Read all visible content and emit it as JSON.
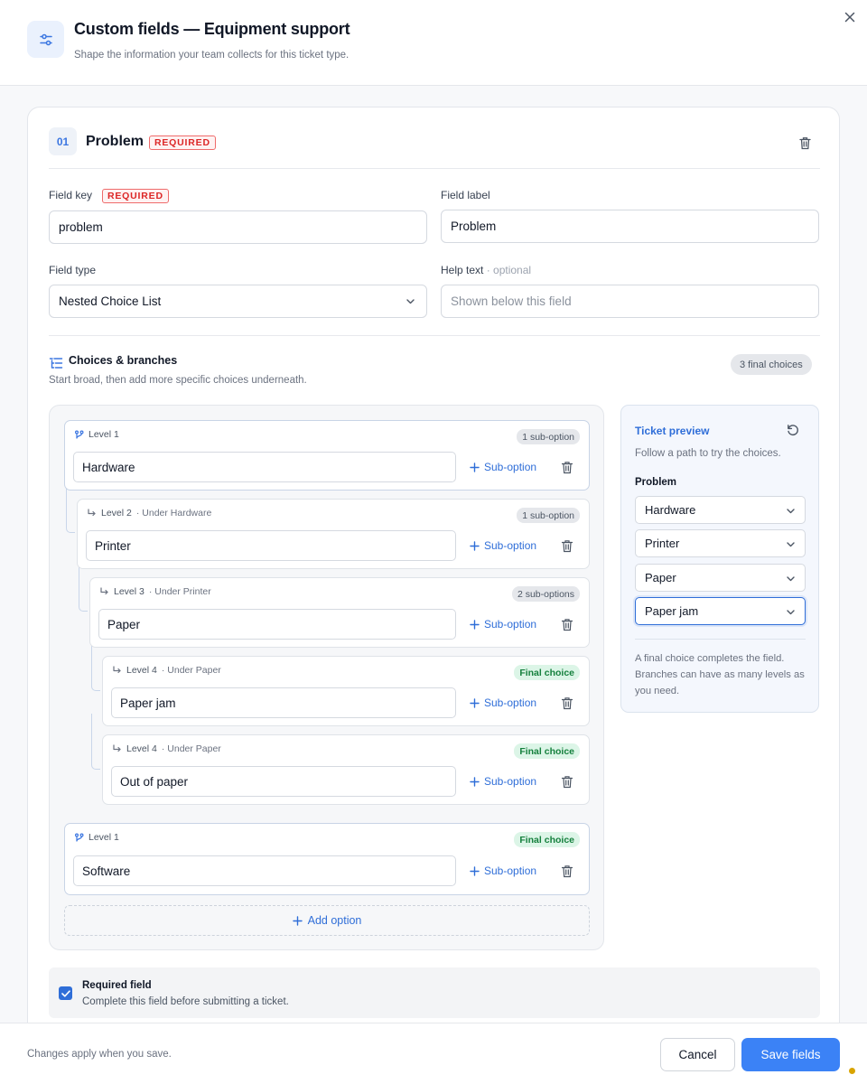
{
  "header": {
    "title": "Custom fields — Equipment support",
    "subtitle": "Shape the information your team collects for this ticket type.",
    "icon": "sliders-icon",
    "close_icon": "close-icon"
  },
  "field": {
    "number": "01",
    "title": "Problem",
    "required_tag": "REQUIRED",
    "delete_icon": "trash-icon",
    "key_label": "Field key",
    "key_required_tag": "REQUIRED",
    "key_value": "problem",
    "label_label": "Field label",
    "label_value": "Problem",
    "type_label": "Field type",
    "type_value": "Nested Choice List",
    "help_label": "Help text",
    "help_optional": "· optional",
    "help_placeholder": "Shown below this field"
  },
  "choices": {
    "title": "Choices & branches",
    "subtitle": "Start broad, then add more specific choices underneath.",
    "final_count": "3 final choices",
    "sub_option_label": "Sub-option",
    "add_option_label": "Add option",
    "nodes": [
      {
        "level": "Level 1",
        "under": "",
        "badge": "1 sub-option",
        "value": "Hardware"
      },
      {
        "level": "Level 2",
        "under": "· Under Hardware",
        "badge": "1 sub-option",
        "value": "Printer"
      },
      {
        "level": "Level 3",
        "under": "· Under Printer",
        "badge": "2 sub-options",
        "value": "Paper"
      },
      {
        "level": "Level 4",
        "under": "· Under Paper",
        "badge": "Final choice",
        "value": "Paper jam"
      },
      {
        "level": "Level 4",
        "under": "· Under Paper",
        "badge": "Final choice",
        "value": "Out of paper"
      },
      {
        "level": "Level 1",
        "under": "",
        "badge": "Final choice",
        "value": "Software"
      }
    ]
  },
  "preview": {
    "title": "Ticket preview",
    "subtitle": "Follow a path to try the choices.",
    "field_label": "Problem",
    "selects": [
      "Hardware",
      "Printer",
      "Paper",
      "Paper jam"
    ],
    "note": "A final choice completes the field. Branches can have as many levels as you need."
  },
  "required": {
    "checked": true,
    "title": "Required field",
    "subtitle": "Complete this field before submitting a ticket."
  },
  "footer": {
    "note": "Changes apply when you save.",
    "cancel": "Cancel",
    "save": "Save fields"
  },
  "colors": {
    "accent": "#3b82f6",
    "link": "#2f6ed8",
    "required": "#dc2626",
    "final_badge_bg": "#dcf5e7",
    "final_badge_text": "#15803d",
    "status_dot": "#d9a400"
  }
}
